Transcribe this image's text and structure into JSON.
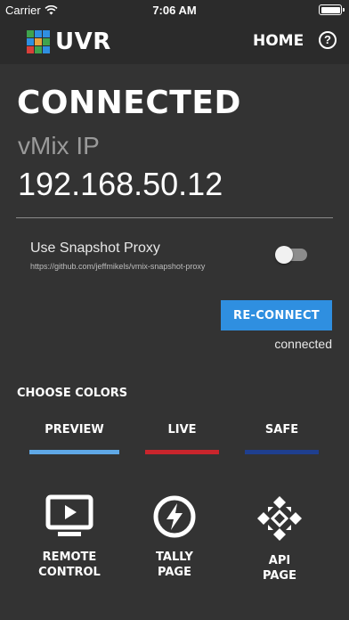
{
  "status_bar": {
    "carrier": "Carrier",
    "time": "7:06 AM"
  },
  "nav": {
    "logo_text": "UVR",
    "home_label": "HOME",
    "help_label": "?",
    "logo_colors": [
      "#3fa34d",
      "#2f8fe0",
      "#2f8fe0",
      "#2f8fe0",
      "#e8a33d",
      "#3fa34d",
      "#d9403a",
      "#3fa34d",
      "#2f8fe0"
    ]
  },
  "connection": {
    "status_title": "CONNECTED",
    "ip_label": "vMix IP",
    "ip_value": "192.168.50.12"
  },
  "proxy": {
    "label": "Use Snapshot Proxy",
    "url": "https://github.com/jeffmikels/vmix-snapshot-proxy",
    "enabled": false
  },
  "reconnect": {
    "button_label": "RE-CONNECT",
    "status_text": "connected"
  },
  "colors": {
    "heading": "CHOOSE COLORS",
    "tabs": [
      {
        "label": "PREVIEW",
        "color": "#5fa8e6"
      },
      {
        "label": "LIVE",
        "color": "#c9252c"
      },
      {
        "label": "SAFE",
        "color": "#1f3f8f"
      }
    ]
  },
  "actions": [
    {
      "label": "REMOTE\nCONTROL",
      "icon": "remote-control-icon"
    },
    {
      "label": "TALLY\nPAGE",
      "icon": "lightning-icon"
    },
    {
      "label": "API\nPAGE",
      "icon": "api-icon"
    }
  ],
  "theme": {
    "background": "#333333",
    "bar_background": "#2b2b2b",
    "accent": "#2f8fe0"
  }
}
